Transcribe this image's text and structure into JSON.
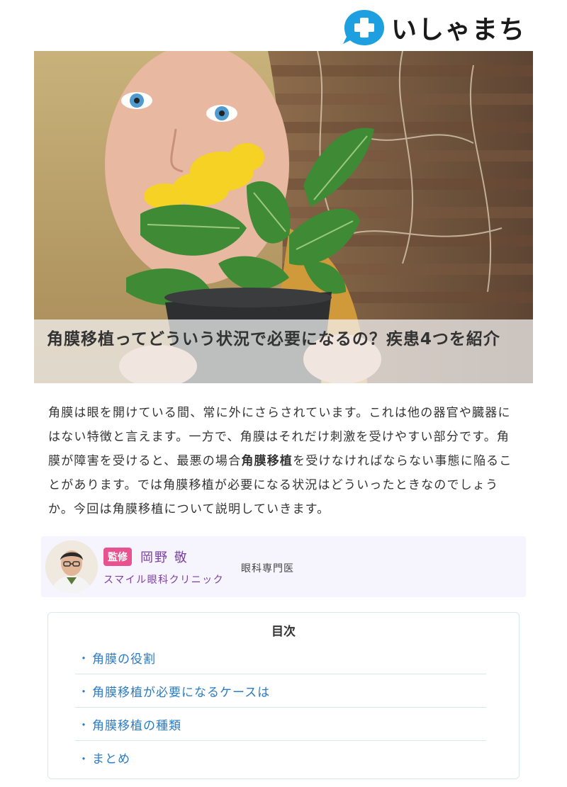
{
  "header": {
    "logo_text": "いしゃまち",
    "logo_icon": "medical-cross-bubble-icon",
    "brand_color": "#1e9fe0"
  },
  "hero": {
    "title": "角膜移植ってどういう状況で必要になるの？疾患4つを紹介"
  },
  "intro": {
    "part1": "角膜は眼を開けている間、常に外にさらされています。これは他の器官や臓器にはない特徴と言えます。一方で、角膜はそれだけ刺激を受けやすい部分です。角膜が障害を受けると、最悪の場合",
    "bold": "角膜移植",
    "part2": "を受けなければならない事態に陥ることがあります。では角膜移植が必要になる状況はどういったときなのでしょうか。今回は角膜移植について説明していきます。"
  },
  "supervisor": {
    "badge": "監修",
    "name": "岡野 敬",
    "clinic": "スマイル眼科クリニック",
    "title": "眼科専門医",
    "accent_color": "#7b3fa5",
    "badge_color": "#e8528f"
  },
  "toc": {
    "title": "目次",
    "bullet": "・",
    "items": [
      {
        "label": "角膜の役割"
      },
      {
        "label": "角膜移植が必要になるケースは"
      },
      {
        "label": "角膜移植の種類"
      },
      {
        "label": "まとめ"
      }
    ],
    "link_color": "#2b7bc6"
  }
}
